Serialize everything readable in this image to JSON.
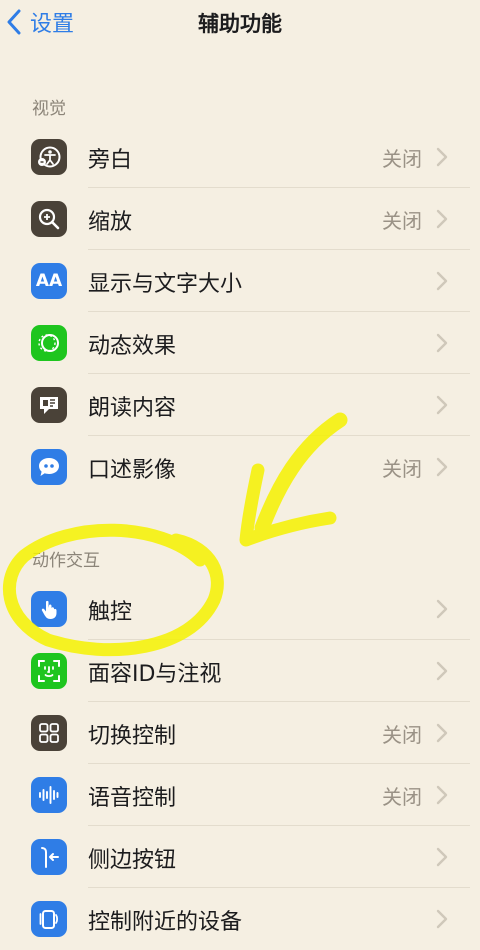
{
  "navbar": {
    "back_label": "设置",
    "title": "辅助功能"
  },
  "colors": {
    "accent": "#2f7de6",
    "highlight": "#f5f200"
  },
  "sections": [
    {
      "header": "视觉",
      "items": [
        {
          "label": "旁白",
          "value": "关闭",
          "icon": "voiceover-icon",
          "icon_bg": "#4a4238"
        },
        {
          "label": "缩放",
          "value": "关闭",
          "icon": "zoom-icon",
          "icon_bg": "#4a4238"
        },
        {
          "label": "显示与文字大小",
          "value": "",
          "icon": "text-size-icon",
          "icon_text": "AA",
          "icon_bg": "#2f7de6"
        },
        {
          "label": "动态效果",
          "value": "",
          "icon": "motion-icon",
          "icon_bg": "#1ec51e"
        },
        {
          "label": "朗读内容",
          "value": "",
          "icon": "spoken-content-icon",
          "icon_bg": "#4a4238"
        },
        {
          "label": "口述影像",
          "value": "关闭",
          "icon": "audio-description-icon",
          "icon_bg": "#2f7de6"
        }
      ]
    },
    {
      "header": "动作交互",
      "items": [
        {
          "label": "触控",
          "value": "",
          "icon": "touch-hand-icon",
          "icon_bg": "#2f7de6"
        },
        {
          "label": "面容ID与注视",
          "value": "",
          "icon": "face-id-icon",
          "icon_bg": "#1ec51e"
        },
        {
          "label": "切换控制",
          "value": "关闭",
          "icon": "switch-control-icon",
          "icon_bg": "#4a4238"
        },
        {
          "label": "语音控制",
          "value": "关闭",
          "icon": "voice-control-icon",
          "icon_bg": "#2f7de6"
        },
        {
          "label": "侧边按钮",
          "value": "",
          "icon": "side-button-icon",
          "icon_bg": "#2f7de6"
        },
        {
          "label": "控制附近的设备",
          "value": "",
          "icon": "nearby-devices-icon",
          "icon_bg": "#2f7de6"
        }
      ]
    }
  ]
}
